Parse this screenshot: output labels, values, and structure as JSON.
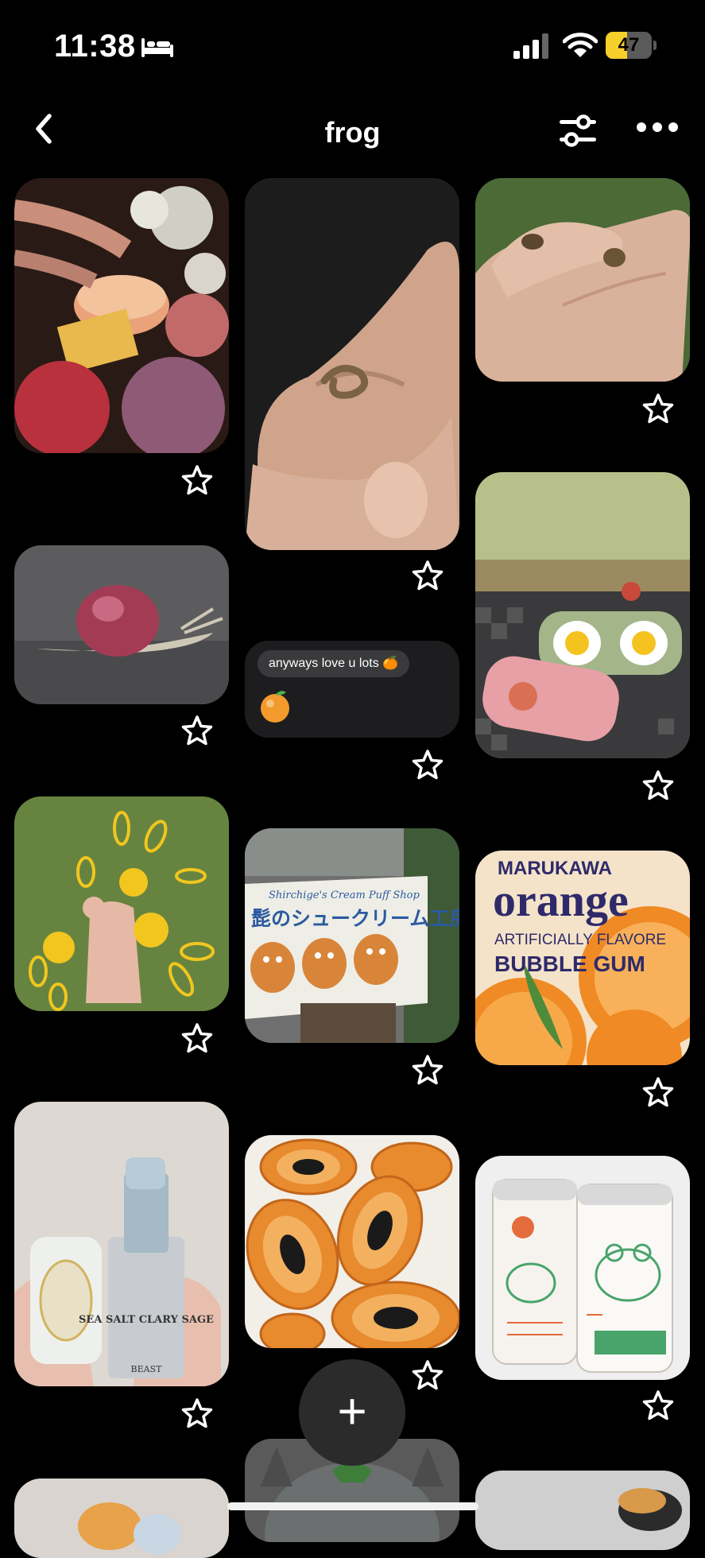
{
  "status": {
    "time": "11:38",
    "battery": "47",
    "battery_level": 0.47
  },
  "header": {
    "title": "frog"
  },
  "icons": {
    "back": "chevron-left-icon",
    "filter": "sliders-icon",
    "more": "ellipsis-icon",
    "bed": "bed-icon",
    "star": "star-outline-icon",
    "add": "plus-icon"
  },
  "chat_card": {
    "message": "anyways love u lots 🍊"
  },
  "fab": {
    "label": "+"
  },
  "pins": [
    "birthday cake with flowers",
    "snake in hands",
    "tiny frogs on fingers",
    "snail with pink shell",
    "anyways love u lots",
    "egg sleep masks",
    "yellow flowers in hand",
    "cream puff shop sign",
    "orange bubble gum wrapper",
    "sea salt clary sage lipstick",
    "papaya dishes",
    "frog beer cans"
  ],
  "images": {
    "cream_puff_sign_en": "Shirchige's Cream Puff Shop",
    "cream_puff_sign_jp": "髭のシュークリーム工房",
    "gum_brand": "MARUKAWA",
    "gum_word": "orange",
    "gum_line1": "ARTIFICIALLY FLAVORE",
    "gum_line2": "BUBBLE GUM",
    "lipstick_name": "SEA SALT CLARY SAGE",
    "lipstick_brand": "BEAST"
  }
}
